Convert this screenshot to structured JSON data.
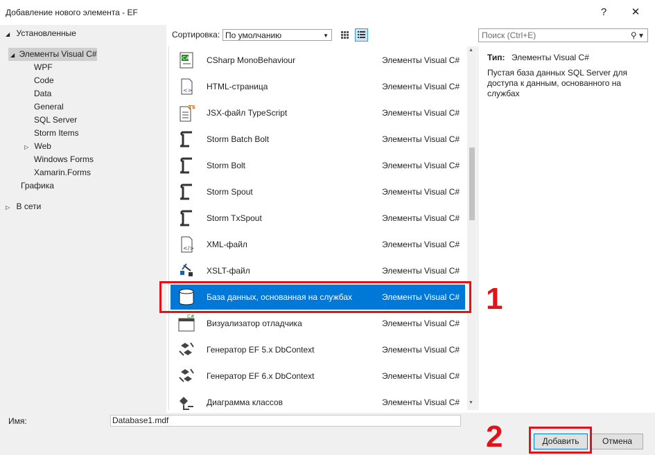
{
  "window": {
    "title": "Добавление нового элемента  - EF",
    "help_glyph": "?",
    "close_glyph": "✕"
  },
  "tree": {
    "installed": "Установленные",
    "root": "Элементы Visual C#",
    "children": [
      "WPF",
      "Code",
      "Data",
      "General",
      "SQL Server",
      "Storm Items",
      "Web",
      "Windows Forms",
      "Xamarin.Forms"
    ],
    "graphics": "Графика",
    "online": "В сети"
  },
  "toolbar": {
    "sort_label": "Сортировка:",
    "sort_value": "По умолчанию",
    "search_placeholder": "Поиск (Ctrl+E)"
  },
  "items": [
    {
      "name": "CSharp MonoBehaviour",
      "category": "Элементы Visual C#",
      "icon": "csharp-file-icon"
    },
    {
      "name": "HTML-страница",
      "category": "Элементы Visual C#",
      "icon": "html-file-icon"
    },
    {
      "name": "JSX-файл TypeScript",
      "category": "Элементы Visual C#",
      "icon": "typescript-file-icon"
    },
    {
      "name": "Storm Batch Bolt",
      "category": "Элементы Visual C#",
      "icon": "storm-icon"
    },
    {
      "name": "Storm Bolt",
      "category": "Элементы Visual C#",
      "icon": "storm-icon"
    },
    {
      "name": "Storm Spout",
      "category": "Элементы Visual C#",
      "icon": "storm-icon"
    },
    {
      "name": "Storm TxSpout",
      "category": "Элементы Visual C#",
      "icon": "storm-icon"
    },
    {
      "name": "XML-файл",
      "category": "Элементы Visual C#",
      "icon": "xml-file-icon"
    },
    {
      "name": "XSLT-файл",
      "category": "Элементы Visual C#",
      "icon": "xslt-file-icon"
    },
    {
      "name": "База данных, основанная на службах",
      "category": "Элементы Visual C#",
      "icon": "database-icon"
    },
    {
      "name": "Визуализатор отладчика",
      "category": "Элементы Visual C#",
      "icon": "visualizer-icon"
    },
    {
      "name": "Генератор EF 5.x DbContext",
      "category": "Элементы Visual C#",
      "icon": "ef-generator-icon"
    },
    {
      "name": "Генератор EF 6.x DbContext",
      "category": "Элементы Visual C#",
      "icon": "ef-generator-icon"
    },
    {
      "name": "Диаграмма классов",
      "category": "Элементы Visual C#",
      "icon": "class-diagram-icon"
    }
  ],
  "description": {
    "type_label": "Тип:",
    "type_value": "Элементы Visual C#",
    "text": "Пустая база данных SQL Server для доступа к данным, основанного на службах"
  },
  "bottom": {
    "name_label": "Имя:",
    "name_value": "Database1.mdf",
    "add_button": "Добавить",
    "cancel_button": "Отмена"
  },
  "annotations": {
    "marker1": "1",
    "marker2": "2"
  },
  "colors": {
    "selection": "#0078d7",
    "highlight": "#e0121a"
  }
}
